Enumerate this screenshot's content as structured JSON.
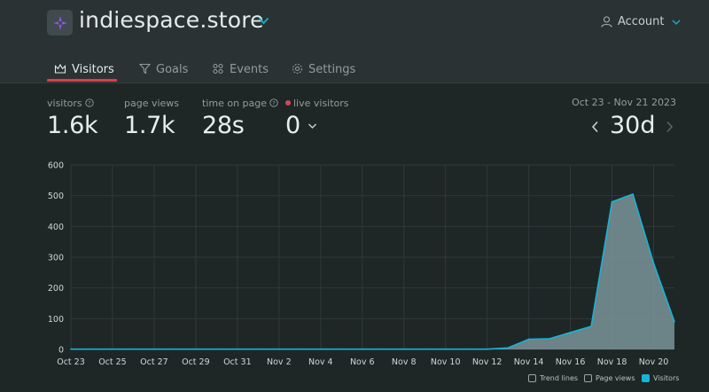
{
  "site": {
    "title": "indiespace.store"
  },
  "account": {
    "label": "Account"
  },
  "tabs": [
    {
      "label": "Visitors",
      "active": true
    },
    {
      "label": "Goals",
      "active": false
    },
    {
      "label": "Events",
      "active": false
    },
    {
      "label": "Settings",
      "active": false
    }
  ],
  "stats": {
    "visitors": {
      "label": "visitors",
      "value": "1.6k"
    },
    "page_views": {
      "label": "page views",
      "value": "1.7k"
    },
    "time_on_page": {
      "label": "time on page",
      "value": "28s"
    },
    "live_visitors": {
      "label": "live visitors",
      "value": "0"
    }
  },
  "range": {
    "dates": "Oct 23 - Nov 21 2023",
    "value": "30d"
  },
  "legend": [
    {
      "label": "Trend lines",
      "checked": false
    },
    {
      "label": "Page views",
      "checked": false
    },
    {
      "label": "Visitors",
      "checked": true
    }
  ],
  "colors": {
    "accent": "#e03c4b",
    "series": "#17b4d6",
    "fill": "#7a9499"
  },
  "chart_data": {
    "type": "area",
    "x": [
      "Oct 23",
      "Oct 24",
      "Oct 25",
      "Oct 26",
      "Oct 27",
      "Oct 28",
      "Oct 29",
      "Oct 30",
      "Oct 31",
      "Nov 1",
      "Nov 2",
      "Nov 3",
      "Nov 4",
      "Nov 5",
      "Nov 6",
      "Nov 7",
      "Nov 8",
      "Nov 9",
      "Nov 10",
      "Nov 11",
      "Nov 12",
      "Nov 13",
      "Nov 14",
      "Nov 15",
      "Nov 16",
      "Nov 17",
      "Nov 18",
      "Nov 19",
      "Nov 20",
      "Nov 21"
    ],
    "xticks": [
      "Oct 23",
      "Oct 25",
      "Oct 27",
      "Oct 29",
      "Oct 31",
      "Nov 2",
      "Nov 4",
      "Nov 6",
      "Nov 8",
      "Nov 10",
      "Nov 12",
      "Nov 14",
      "Nov 16",
      "Nov 18",
      "Nov 20"
    ],
    "yticks": [
      0,
      100,
      200,
      300,
      400,
      500,
      600
    ],
    "ylim": [
      0,
      600
    ],
    "series": [
      {
        "name": "Visitors",
        "values": [
          1,
          1,
          1,
          1,
          1,
          1,
          1,
          1,
          1,
          1,
          1,
          1,
          1,
          1,
          1,
          1,
          1,
          1,
          1,
          1,
          1,
          5,
          33,
          35,
          55,
          75,
          480,
          505,
          280,
          90
        ]
      }
    ],
    "grid": true,
    "legend_position": "bottom-right"
  }
}
